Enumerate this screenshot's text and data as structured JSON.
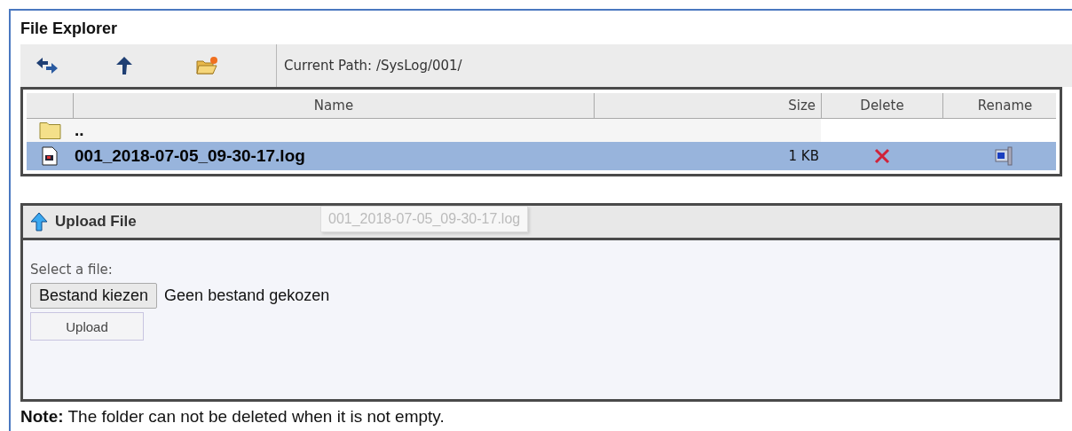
{
  "title": "File Explorer",
  "toolbar": {
    "path_label": "Current Path: /SysLog/001/"
  },
  "table": {
    "columns": [
      "Name",
      "Size",
      "Delete",
      "Rename"
    ],
    "rows": [
      {
        "kind": "folder",
        "name": "..",
        "size": "",
        "selected": false
      },
      {
        "kind": "file",
        "name": "001_2018-07-05_09-30-17.log",
        "size": "1 KB",
        "selected": true
      }
    ]
  },
  "upload": {
    "title": "Upload File",
    "tooltip": "001_2018-07-05_09-30-17.log",
    "select_label": "Select a file:",
    "choose_button": "Bestand kiezen",
    "file_status": "Geen bestand gekozen",
    "upload_button": "Upload"
  },
  "note": "**Note:** The folder can not be deleted when it is not empty."
}
